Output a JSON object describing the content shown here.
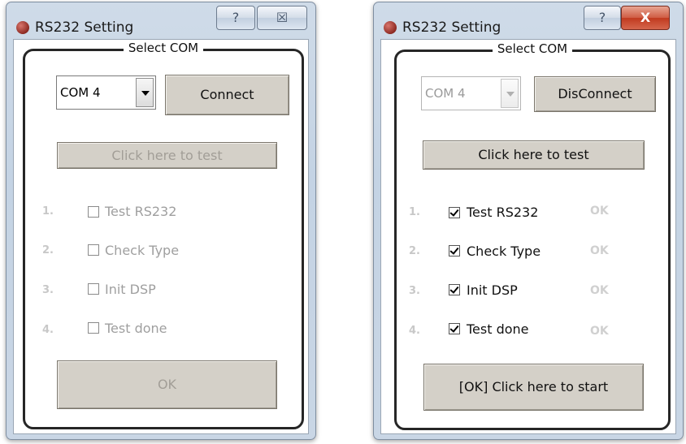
{
  "left_window": {
    "title": "RS232 Setting",
    "help_glyph": "?",
    "close_glyph": "☒",
    "group_title": "Select COM",
    "com_value": "COM 4",
    "connect_label": "Connect",
    "test_label": "Click here to test",
    "items": [
      {
        "num": "1.",
        "label": "Test RS232",
        "checked": false
      },
      {
        "num": "2.",
        "label": "Check Type",
        "checked": false
      },
      {
        "num": "3.",
        "label": "Init DSP",
        "checked": false
      },
      {
        "num": "4.",
        "label": "Test done",
        "checked": false
      }
    ],
    "ok_label": "OK"
  },
  "right_window": {
    "title": "RS232 Setting",
    "help_glyph": "?",
    "close_glyph": "X",
    "group_title": "Select COM",
    "com_value": "COM 4",
    "disconnect_label": "DisConnect",
    "test_label": "Click here to test",
    "items": [
      {
        "num": "1.",
        "label": "Test RS232",
        "checked": true,
        "status": "OK"
      },
      {
        "num": "2.",
        "label": "Check Type",
        "checked": true,
        "status": "OK"
      },
      {
        "num": "3.",
        "label": "Init DSP",
        "checked": true,
        "status": "OK"
      },
      {
        "num": "4.",
        "label": "Test done",
        "checked": true,
        "status": "OK"
      }
    ],
    "start_label": "[OK] Click here to start"
  },
  "colors": {
    "titlebar": "#c9d6e5",
    "button_face": "#d4d0c8",
    "group_border": "#262626",
    "close_active": "#c13a1f",
    "disabled_text": "#a29e97"
  }
}
